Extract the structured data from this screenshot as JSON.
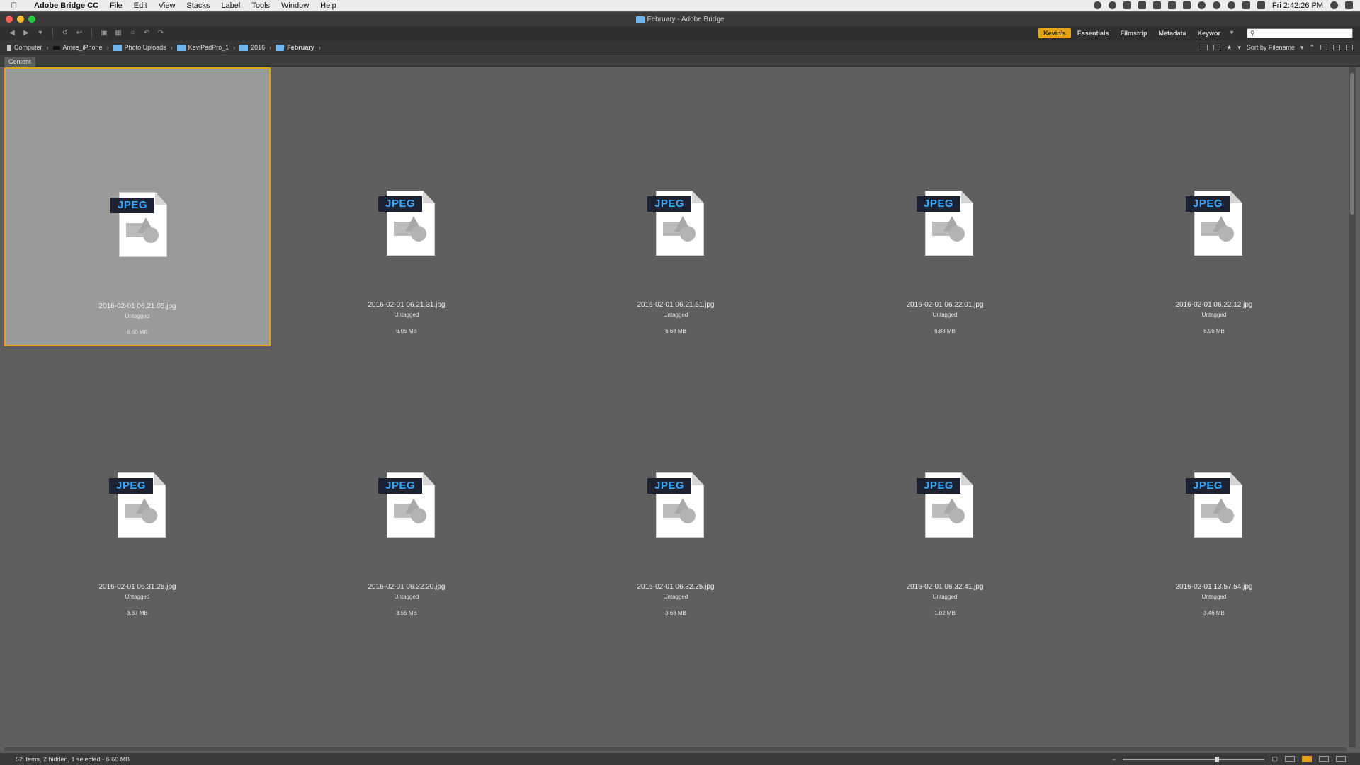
{
  "menubar": {
    "app_name": "Adobe Bridge CC",
    "items": [
      "File",
      "Edit",
      "View",
      "Stacks",
      "Label",
      "Tools",
      "Window",
      "Help"
    ],
    "clock": "Fri 2:42:26 PM"
  },
  "window": {
    "title": "February - Adobe Bridge"
  },
  "toolbar": {
    "workspaces": [
      "Kevin's",
      "Essentials",
      "Filmstrip",
      "Metadata",
      "Keywor"
    ],
    "active_workspace": "Kevin's",
    "search_placeholder": "",
    "accent": "#e6a317"
  },
  "breadcrumb": {
    "items": [
      "Computer",
      "Ames_iPhone",
      "Photo Uploads",
      "KeviPadPro_1",
      "2016",
      "February"
    ]
  },
  "sort": {
    "label": "Sort by Filename"
  },
  "panel": {
    "tab": "Content"
  },
  "files": [
    {
      "name": "2016-02-01 06.21.05.jpg",
      "tag": "Untagged",
      "size": "6.60 MB",
      "selected": true
    },
    {
      "name": "2016-02-01 06.21.31.jpg",
      "tag": "Untagged",
      "size": "6.05 MB"
    },
    {
      "name": "2016-02-01 06.21.51.jpg",
      "tag": "Untagged",
      "size": "6.68 MB"
    },
    {
      "name": "2016-02-01 06.22.01.jpg",
      "tag": "Untagged",
      "size": "6.88 MB"
    },
    {
      "name": "2016-02-01 06.22.12.jpg",
      "tag": "Untagged",
      "size": "6.96 MB"
    },
    {
      "name": "2016-02-01 06.31.25.jpg",
      "tag": "Untagged",
      "size": "3.37 MB"
    },
    {
      "name": "2016-02-01 06.32.20.jpg",
      "tag": "Untagged",
      "size": "3.55 MB"
    },
    {
      "name": "2016-02-01 06.32.25.jpg",
      "tag": "Untagged",
      "size": "3.68 MB"
    },
    {
      "name": "2016-02-01 06.32.41.jpg",
      "tag": "Untagged",
      "size": "1.02 MB"
    },
    {
      "name": "2016-02-01 13.57.54.jpg",
      "tag": "Untagged",
      "size": "3.46 MB"
    }
  ],
  "file_badge": "JPEG",
  "status": {
    "text": "52 items, 2 hidden, 1 selected - 6.60 MB"
  }
}
